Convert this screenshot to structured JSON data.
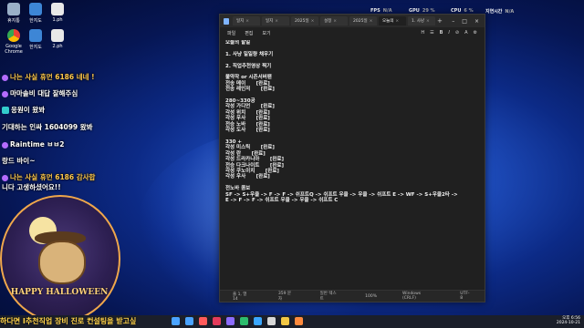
{
  "desktop": {
    "icons": [
      {
        "label": "휴지통",
        "color": "#9ab0c8"
      },
      {
        "label": "한지도",
        "color": "#3d86d6"
      },
      {
        "label": "1.ph",
        "color": "#e8e8e8"
      },
      {
        "label": "Google Chrome",
        "color": "#e94235"
      },
      {
        "label": "한지도",
        "color": "#3d86d6"
      },
      {
        "label": "2.ph",
        "color": "#e8e8e8"
      }
    ]
  },
  "chat": [
    {
      "text": "나는 사실 휴먼 6186 네네 !",
      "nick_color": "#ffc94d"
    },
    {
      "text": "마마솔비 대답 잘해주심",
      "nick_color": "#ffffff"
    },
    {
      "text": "응원이 왔봐",
      "nick_color": "#ffffff"
    },
    {
      "text": "기대하는 인싸 1604099 왔봐",
      "nick_color": "#ffffff"
    },
    {
      "text": "Raintime ㅂㅂ2",
      "nick_color": "#ffffff"
    },
    {
      "text": "랑드 바이~",
      "nick_color": "#ffffff"
    },
    {
      "text": "나는 사실 휴먼 6186 감사합",
      "nick_color": "#ffc94d"
    },
    {
      "text": "니다 고생하셨어요!!",
      "nick_color": "#ffffff"
    }
  ],
  "halloween": {
    "banner": "HAPPY HALLOWEEN"
  },
  "hud": {
    "fps_label": "FPS",
    "fps_value": "N/A",
    "gpu_label": "GPU",
    "gpu_value": "29 %",
    "cpu_label": "CPU",
    "cpu_value": "6 %",
    "mem_label": "지연시간",
    "mem_value": "N/A"
  },
  "notepad": {
    "tabs": [
      "일지",
      "일지",
      "2025일",
      "설정",
      "2025일",
      "오늘의",
      "1. 사냥"
    ],
    "active_tab": 5,
    "menu": [
      "파일",
      "편집",
      "보기"
    ],
    "tools": {
      "heading": "H",
      "list": "☰",
      "bold": "B",
      "italic": "I",
      "link": "⊘",
      "clear": "A"
    },
    "content": "오늘의 할일\n\n1. 사냥 일일량 채우기\n\n2. 직업추천영상 찍기\n\n불약작 or 시즌서버팬\n전송 메이      [완료]\n전송 레인저      [완료]\n\n280~330공\n각성 가디언      [완료]\n각성 위치      [완료]\n각성 우사      [완료]\n전승 노바      [완료]\n각성 도사      [완료]\n\n330 +\n각성 미스틱      [완료]\n각성 란      [완료]\n각성 드라카니아      [완료]\n전승 다크나이트      [완료]\n각성 쿠노이치      [완료]\n각성 우사      [완료]\n\n전노바 콤보\nSF -> S+우클 -> F -> F -> 쉬프트Q -> 쉬프트 우클 -> 우클 -> 쉬프트 E -> WF -> S+우클2타 ->\nE -> F -> F -> 쉬프트 우클 -> 우클 -> 쉬프트 C",
    "status": [
      "줄 1, 열 14",
      "359 문자",
      "일반 텍스트",
      "100%",
      "Windows (CRLF)",
      "UTF-8"
    ]
  },
  "taskbar": {
    "ticker": "하다면 I추천직업    장비 진로 컨설팅을 받고싶",
    "time": "오후 6:56",
    "date": "2024-10-21",
    "app_colors": [
      "#4aa3ff",
      "#4aa3ff",
      "#ff5a5a",
      "#e33b5b",
      "#8c6cff",
      "#2dbd6e",
      "#3ba7ff",
      "#d8d8d8",
      "#f2c744",
      "#ff8a3d"
    ]
  }
}
